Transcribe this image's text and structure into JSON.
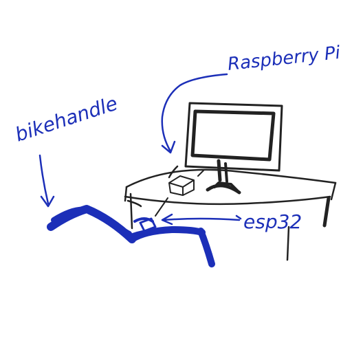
{
  "sketch": {
    "ink_color": "#1c2fb8",
    "pencil_color": "#222222",
    "labels": {
      "raspberry": "Raspberry Pi",
      "bike": "bikehandle",
      "esp": "esp32"
    }
  }
}
